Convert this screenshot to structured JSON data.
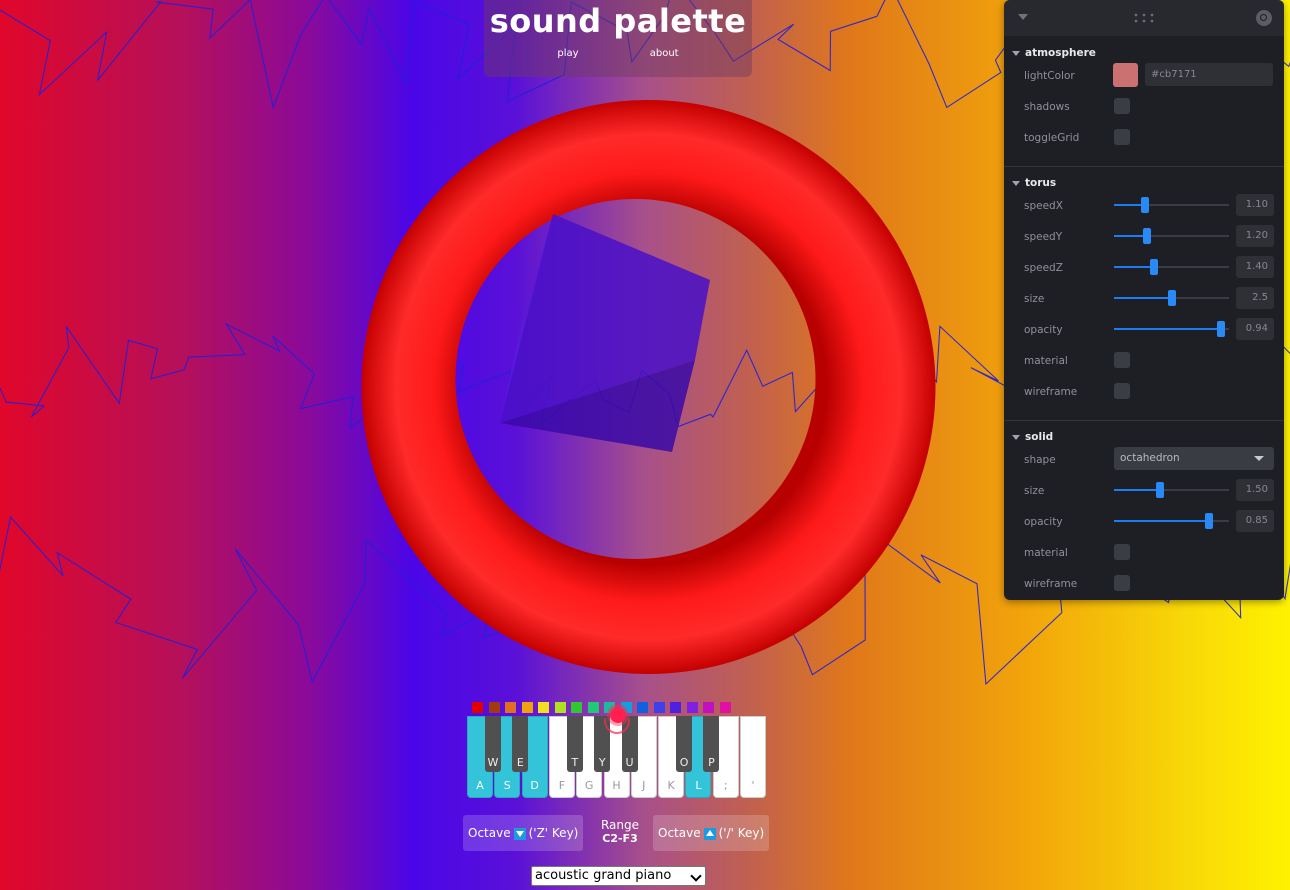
{
  "app": {
    "title": "sound palette",
    "nav": [
      "play",
      "about"
    ]
  },
  "gui": {
    "folders": {
      "atmosphere": {
        "title": "atmosphere",
        "lightColor_label": "lightColor",
        "lightColor_value": "#cb7171",
        "shadows_label": "shadows",
        "shadows_checked": false,
        "toggleGrid_label": "toggleGrid",
        "toggleGrid_checked": false
      },
      "torus": {
        "title": "torus",
        "speedX_label": "speedX",
        "speedX_value": "1.10",
        "speedY_label": "speedY",
        "speedY_value": "1.20",
        "speedZ_label": "speedZ",
        "speedZ_value": "1.40",
        "size_label": "size",
        "size_value": "2.5",
        "opacity_label": "opacity",
        "opacity_value": "0.94",
        "material_label": "material",
        "material_checked": false,
        "wireframe_label": "wireframe",
        "wireframe_checked": false
      },
      "solid": {
        "title": "solid",
        "shape_label": "shape",
        "shape_value": "octahedron",
        "size_label": "size",
        "size_value": "1.50",
        "opacity_label": "opacity",
        "opacity_value": "0.85",
        "material_label": "material",
        "material_checked": false,
        "wireframe_label": "wireframe",
        "wireframe_checked": false
      }
    }
  },
  "sliders": {
    "speedX": 0.27,
    "speedY": 0.29,
    "speedZ": 0.35,
    "torus_size": 0.5,
    "torus_opacity": 0.93,
    "solid_size": 0.4,
    "solid_opacity": 0.83
  },
  "colors": {
    "torus": "#ff1a1a",
    "solid": "#5518c8",
    "wire": "#2020d8",
    "swatches": [
      "#e00000",
      "#a03a10",
      "#e07020",
      "#f0a010",
      "#f0e020",
      "#b0e020",
      "#30c830",
      "#20c878",
      "#20b8a0",
      "#10a0e0",
      "#1060e0",
      "#4040e8",
      "#5020e0",
      "#8020e0",
      "#c010c0",
      "#e010a0"
    ]
  },
  "keyboard": {
    "white_keys": [
      "A",
      "S",
      "D",
      "F",
      "G",
      "H",
      "J",
      "K",
      "L",
      ";",
      "'"
    ],
    "white_active": [
      true,
      true,
      true,
      false,
      false,
      false,
      false,
      false,
      true,
      false,
      false
    ],
    "black_keys": [
      "W",
      "E",
      "T",
      "Y",
      "U",
      "O",
      "P"
    ]
  },
  "controls": {
    "octave_down_label": "Octave",
    "octave_down_key": "('Z' Key)",
    "range_label": "Range",
    "range_value": "C2-F3",
    "octave_up_label": "Octave",
    "octave_up_key": "('/' Key)",
    "instrument": "acoustic grand piano"
  }
}
